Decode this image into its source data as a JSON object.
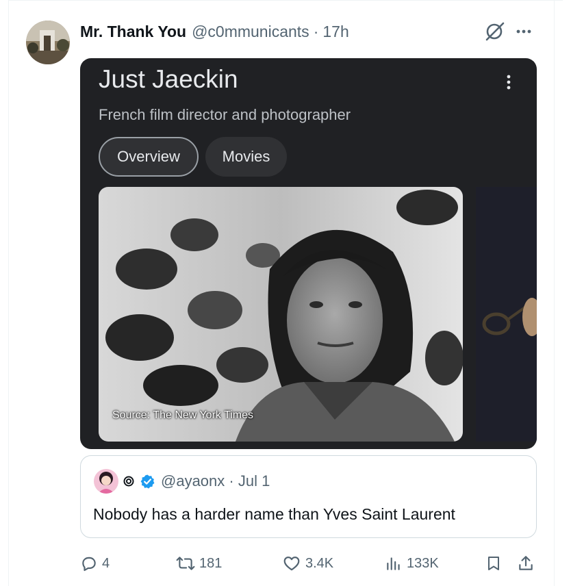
{
  "tweet": {
    "author": "Mr. Thank You",
    "handle": "@c0mmunicants",
    "separator": "·",
    "time": "17h"
  },
  "card": {
    "title": "Just Jaeckin",
    "subtitle": "French film director and photographer",
    "tabs": [
      {
        "label": "Overview",
        "selected": true
      },
      {
        "label": "Movies",
        "selected": false
      }
    ],
    "image_source": "Source: The New York Times"
  },
  "quoted": {
    "handle": "@ayaonx",
    "separator": "·",
    "date": "Jul 1",
    "text": "Nobody has a harder name than Yves Saint Laurent"
  },
  "actions": {
    "replies": "4",
    "reposts": "181",
    "likes": "3.4K",
    "views": "133K"
  },
  "icons": [
    "grok-icon",
    "more-icon",
    "kebab-icon",
    "reply-icon",
    "repost-icon",
    "like-icon",
    "views-icon",
    "bookmark-icon",
    "share-icon",
    "verified-icon",
    "spiral-icon"
  ],
  "colors": {
    "text": "#0f1419",
    "muted": "#536471",
    "card_bg": "#202124",
    "verified": "#1d9bf0"
  }
}
